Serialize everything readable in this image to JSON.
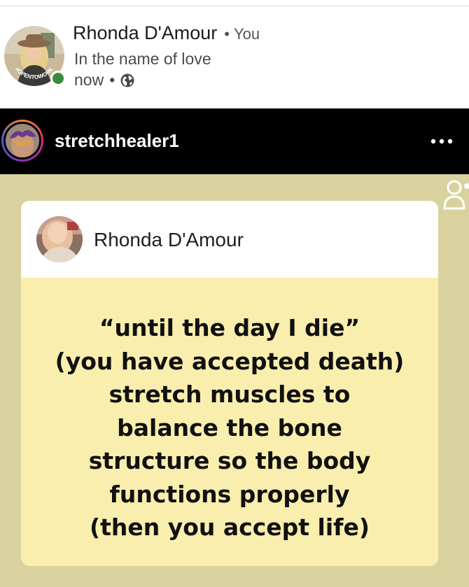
{
  "post": {
    "author_name": "Rhonda D'Amour",
    "separator": "•",
    "relation": "You",
    "headline": "In the name of love",
    "time": "now",
    "time_separator": "•",
    "avatar_badge_text": "#OPENTOWORK",
    "online_status_color": "#3a8a3a",
    "globe_icon": "globe-icon"
  },
  "story": {
    "username": "stretchhealer1",
    "more_icon": "more-horizontal-icon",
    "tag_icon": "person-tag-icon",
    "background_color": "#d9d29e",
    "card": {
      "author_name": "Rhonda D'Amour",
      "background_color": "#f9eeae",
      "quote_lines": [
        "“until the day I die”",
        "(you have accepted death)",
        "stretch muscles to",
        "balance the bone",
        "structure so the body",
        "functions properly",
        "(then you accept life)"
      ]
    }
  }
}
